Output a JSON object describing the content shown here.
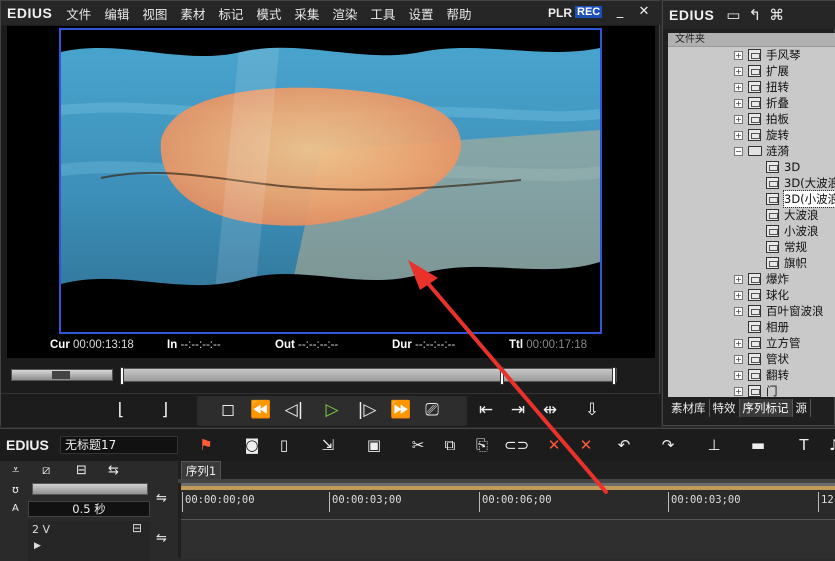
{
  "player": {
    "brand": "EDIUS",
    "menu": [
      "文件",
      "编辑",
      "视图",
      "素材",
      "标记",
      "模式",
      "采集",
      "渲染",
      "工具",
      "设置",
      "帮助"
    ],
    "plr": "PLR",
    "rec": "REC",
    "timecodes": {
      "cur_label": "Cur",
      "cur_value": "00:00:13:18",
      "in_label": "In",
      "in_value": "--:--:--:--",
      "out_label": "Out",
      "out_value": "--:--:--:--",
      "dur_label": "Dur",
      "dur_value": "--:--:--:--",
      "ttl_label": "Ttl",
      "ttl_value": "00:00:17:18"
    }
  },
  "bin": {
    "brand": "EDIUS",
    "folder_header": "文件夹",
    "tree": [
      {
        "label": "手风琴",
        "type": "node",
        "expander": "+"
      },
      {
        "label": "扩展",
        "type": "node",
        "expander": "+"
      },
      {
        "label": "扭转",
        "type": "node",
        "expander": "+"
      },
      {
        "label": "折叠",
        "type": "node",
        "expander": "+"
      },
      {
        "label": "拍板",
        "type": "node",
        "expander": "+"
      },
      {
        "label": "旋转",
        "type": "node",
        "expander": "+"
      },
      {
        "label": "涟漪",
        "type": "folder",
        "expander": "−"
      },
      {
        "label": "3D",
        "type": "child"
      },
      {
        "label": "3D(大波浪",
        "type": "child"
      },
      {
        "label": "3D(小波浪",
        "type": "child",
        "selected": true
      },
      {
        "label": "大波浪",
        "type": "child"
      },
      {
        "label": "小波浪",
        "type": "child"
      },
      {
        "label": "常规",
        "type": "child"
      },
      {
        "label": "旗帜",
        "type": "child"
      },
      {
        "label": "爆炸",
        "type": "node",
        "expander": "+"
      },
      {
        "label": "球化",
        "type": "node",
        "expander": "+"
      },
      {
        "label": "百叶窗波浪",
        "type": "node",
        "expander": "+"
      },
      {
        "label": "相册",
        "type": "node",
        "expander": ""
      },
      {
        "label": "立方管",
        "type": "node",
        "expander": "+"
      },
      {
        "label": "管状",
        "type": "node",
        "expander": "+"
      },
      {
        "label": "翻转",
        "type": "node",
        "expander": "+"
      },
      {
        "label": "门",
        "type": "node",
        "expander": "+"
      }
    ],
    "tabs": [
      "素材库",
      "特效",
      "序列标记",
      "源"
    ]
  },
  "timeline": {
    "brand": "EDIUS",
    "project_name": "无标题17",
    "sequence_tab": "序列1",
    "zoom": "0.5 秒",
    "track_name": "2 V",
    "ruler_labels": [
      "00:00:00;00",
      "00:00:03;00",
      "00:00:06;00",
      "00:00:03;00",
      "12"
    ]
  },
  "colors": {
    "monitor_border": "#2f56d6",
    "rec_badge": "#1c4fb8",
    "play_green": "#7fd64a",
    "annotation_arrow": "#e8322a"
  }
}
